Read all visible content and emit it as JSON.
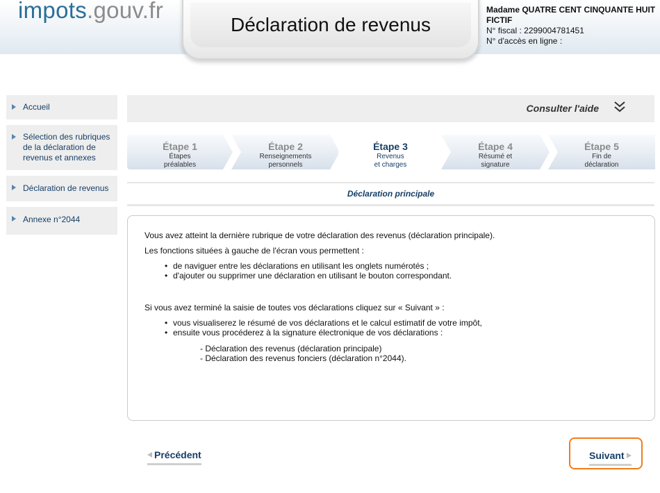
{
  "header": {
    "logo_main": "impots",
    "logo_suffix": ".gouv.fr",
    "title": "Déclaration de revenus",
    "user_name": "Madame QUATRE CENT CINQUANTE HUIT FICTIF",
    "fiscal_number": "N° fiscal : 2299004781451",
    "access_number": "N° d'accès en ligne :"
  },
  "sidebar": {
    "items": [
      {
        "label": "Accueil"
      },
      {
        "label": "Sélection des rubriques de la déclaration de revenus et annexes"
      },
      {
        "label": "Déclaration de revenus"
      },
      {
        "label": "Annexe n°2044"
      }
    ]
  },
  "help": {
    "label": "Consulter l'aide",
    "icon": "double-chevron-down-icon"
  },
  "steps": [
    {
      "num": "Étape 1",
      "line1": "Étapes",
      "line2": "préalables",
      "current": false
    },
    {
      "num": "Étape 2",
      "line1": "Renseignements",
      "line2": "personnels",
      "current": false
    },
    {
      "num": "Étape 3",
      "line1": "Revenus",
      "line2": "et charges",
      "current": true
    },
    {
      "num": "Étape 4",
      "line1": "Résumé et",
      "line2": "signature",
      "current": false
    },
    {
      "num": "Étape 5",
      "line1": "Fin de",
      "line2": "déclaration",
      "current": false
    }
  ],
  "section_title": "Déclaration principale",
  "content": {
    "p1": "Vous avez atteint la dernière rubrique de votre déclaration des revenus (déclaration principale).",
    "p2": "Les fonctions situées à gauche de l'écran vous permettent :",
    "list1": [
      "de naviguer entre les déclarations en utilisant les onglets numérotés ;",
      "d'ajouter ou supprimer une déclaration en utilisant le bouton correspondant."
    ],
    "p3": "Si vous avez terminé la saisie de toutes vos déclarations cliquez sur « Suivant » :",
    "list2": [
      "vous visualiserez le résumé de vos déclarations et le calcul estimatif de votre impôt,",
      "ensuite vous procéderez à la signature électronique de vos déclarations :"
    ],
    "sub1": "- Déclaration des revenus (déclaration principale)",
    "sub2": "- Déclaration des revenus fonciers (déclaration n°2044)."
  },
  "nav": {
    "previous": "Précédent",
    "next": "Suivant"
  },
  "colors": {
    "accent_blue": "#163e66",
    "logo_blue": "#2a6f9b",
    "highlight_orange": "#f07d1a"
  }
}
